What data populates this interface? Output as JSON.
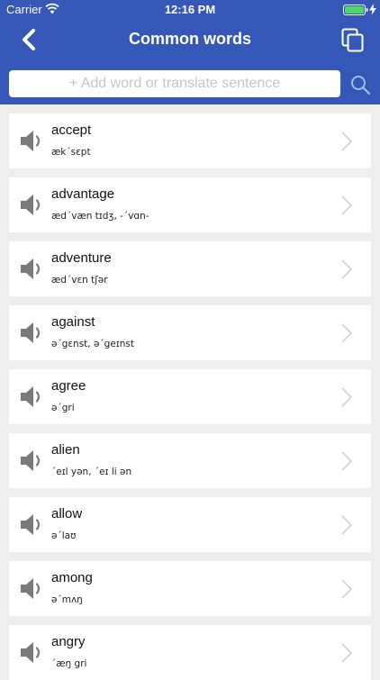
{
  "status_bar": {
    "carrier": "Carrier",
    "time": "12:16 PM"
  },
  "header": {
    "title": "Common words",
    "background_color": "#3457b8"
  },
  "search": {
    "placeholder": "+ Add word or translate sentence",
    "value": ""
  },
  "words": [
    {
      "word": "accept",
      "phonetic": "æk΄sɛpt"
    },
    {
      "word": "advantage",
      "phonetic": "æd΄væn tɪdʒ, -΄vɑn-"
    },
    {
      "word": "adventure",
      "phonetic": "æd΄vɛn tʃər"
    },
    {
      "word": "against",
      "phonetic": "ə΄gɛnst, ə΄geɪnst"
    },
    {
      "word": "agree",
      "phonetic": "ə΄gri"
    },
    {
      "word": "alien",
      "phonetic": "΄eɪl yən, ΄eɪ li ən"
    },
    {
      "word": "allow",
      "phonetic": "ə΄laʊ"
    },
    {
      "word": "among",
      "phonetic": "ə΄mʌŋ"
    },
    {
      "word": "angry",
      "phonetic": "΄æŋ gri"
    }
  ],
  "icons": {
    "back": "chevron-left-icon",
    "copy": "copy-icon",
    "search": "search-icon",
    "speaker": "speaker-icon",
    "row_arrow": "chevron-right-icon"
  }
}
